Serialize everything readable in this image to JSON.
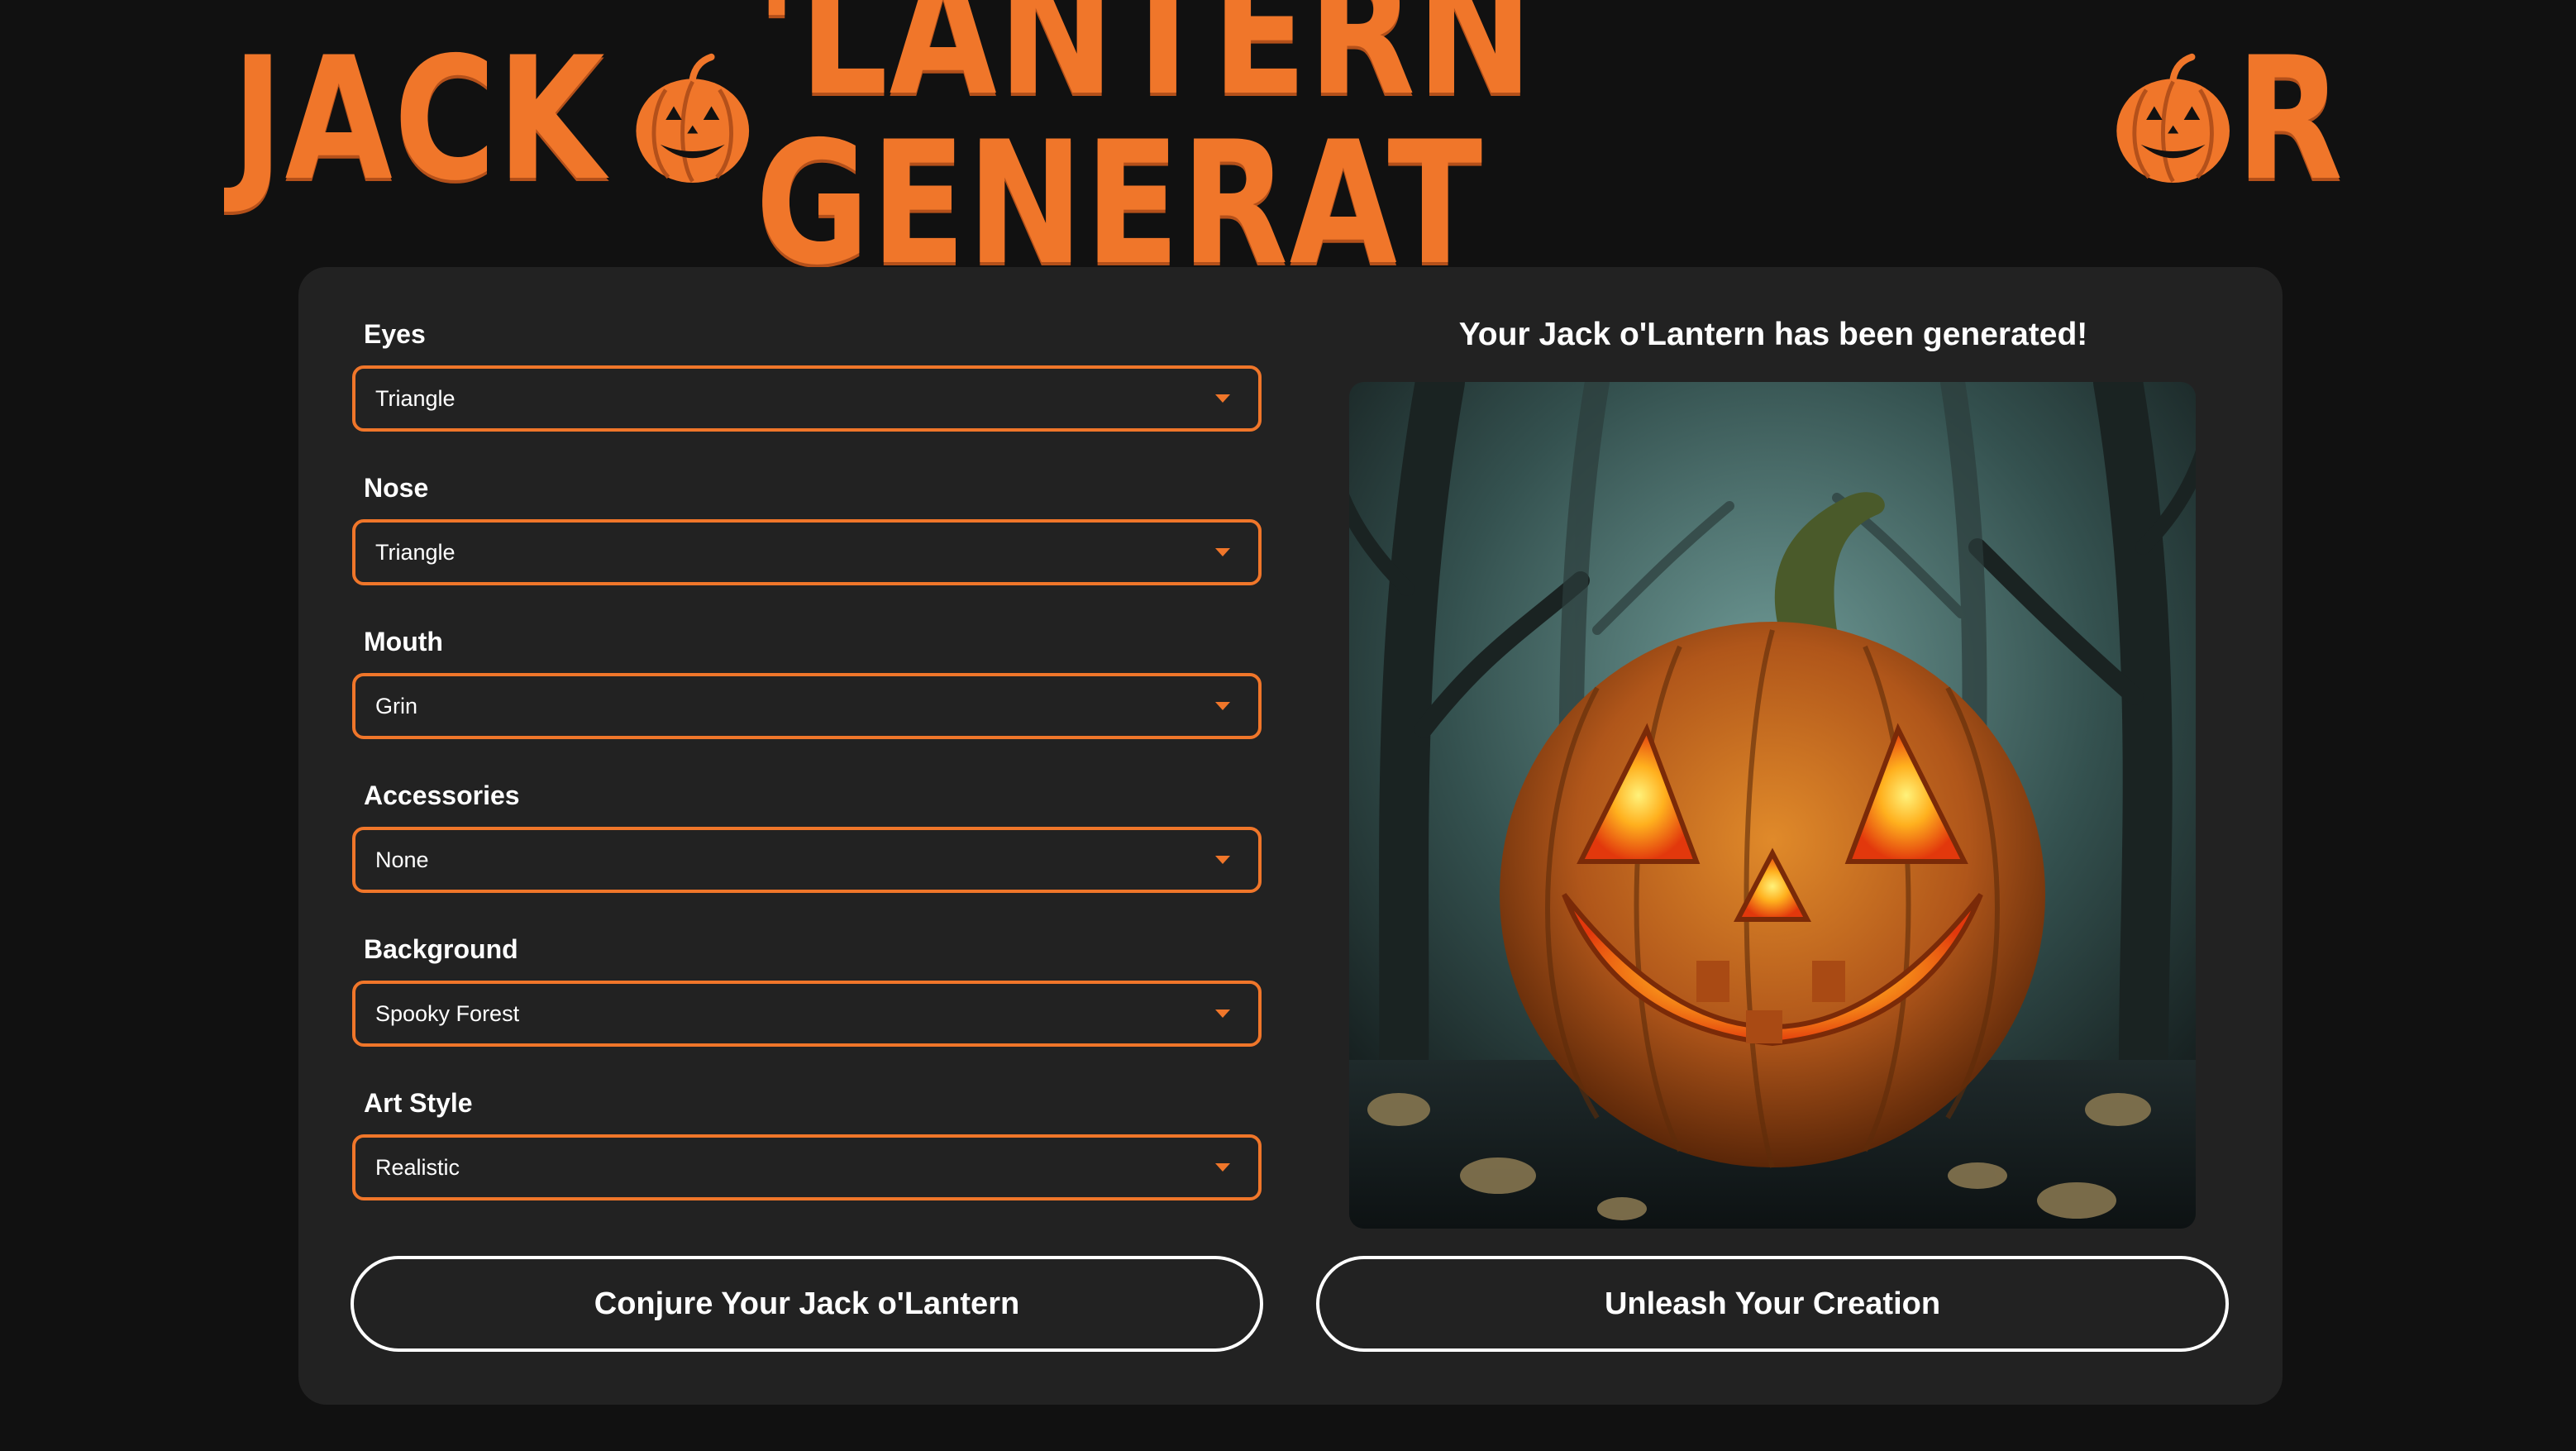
{
  "header": {
    "title_part1": "JACK",
    "title_part2": "'LANTERN GENERAT",
    "title_part3": "R"
  },
  "form": {
    "fields": [
      {
        "label": "Eyes",
        "value": "Triangle"
      },
      {
        "label": "Nose",
        "value": "Triangle"
      },
      {
        "label": "Mouth",
        "value": "Grin"
      },
      {
        "label": "Accessories",
        "value": "None"
      },
      {
        "label": "Background",
        "value": "Spooky Forest"
      },
      {
        "label": "Art Style",
        "value": "Realistic"
      }
    ]
  },
  "result": {
    "message": "Your Jack o'Lantern has been generated!"
  },
  "buttons": {
    "conjure": "Conjure Your Jack o'Lantern",
    "unleash": "Unleash Your Creation"
  },
  "colors": {
    "accent": "#f0762a",
    "background": "#111111",
    "panel": "#222222"
  }
}
